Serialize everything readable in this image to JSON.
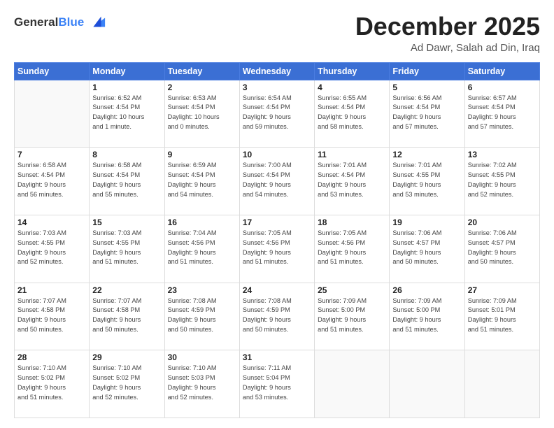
{
  "header": {
    "logo_general": "General",
    "logo_blue": "Blue",
    "month_title": "December 2025",
    "subtitle": "Ad Dawr, Salah ad Din, Iraq"
  },
  "weekdays": [
    "Sunday",
    "Monday",
    "Tuesday",
    "Wednesday",
    "Thursday",
    "Friday",
    "Saturday"
  ],
  "weeks": [
    [
      {
        "day": "",
        "info": ""
      },
      {
        "day": "1",
        "info": "Sunrise: 6:52 AM\nSunset: 4:54 PM\nDaylight: 10 hours\nand 1 minute."
      },
      {
        "day": "2",
        "info": "Sunrise: 6:53 AM\nSunset: 4:54 PM\nDaylight: 10 hours\nand 0 minutes."
      },
      {
        "day": "3",
        "info": "Sunrise: 6:54 AM\nSunset: 4:54 PM\nDaylight: 9 hours\nand 59 minutes."
      },
      {
        "day": "4",
        "info": "Sunrise: 6:55 AM\nSunset: 4:54 PM\nDaylight: 9 hours\nand 58 minutes."
      },
      {
        "day": "5",
        "info": "Sunrise: 6:56 AM\nSunset: 4:54 PM\nDaylight: 9 hours\nand 57 minutes."
      },
      {
        "day": "6",
        "info": "Sunrise: 6:57 AM\nSunset: 4:54 PM\nDaylight: 9 hours\nand 57 minutes."
      }
    ],
    [
      {
        "day": "7",
        "info": "Sunrise: 6:58 AM\nSunset: 4:54 PM\nDaylight: 9 hours\nand 56 minutes."
      },
      {
        "day": "8",
        "info": "Sunrise: 6:58 AM\nSunset: 4:54 PM\nDaylight: 9 hours\nand 55 minutes."
      },
      {
        "day": "9",
        "info": "Sunrise: 6:59 AM\nSunset: 4:54 PM\nDaylight: 9 hours\nand 54 minutes."
      },
      {
        "day": "10",
        "info": "Sunrise: 7:00 AM\nSunset: 4:54 PM\nDaylight: 9 hours\nand 54 minutes."
      },
      {
        "day": "11",
        "info": "Sunrise: 7:01 AM\nSunset: 4:54 PM\nDaylight: 9 hours\nand 53 minutes."
      },
      {
        "day": "12",
        "info": "Sunrise: 7:01 AM\nSunset: 4:55 PM\nDaylight: 9 hours\nand 53 minutes."
      },
      {
        "day": "13",
        "info": "Sunrise: 7:02 AM\nSunset: 4:55 PM\nDaylight: 9 hours\nand 52 minutes."
      }
    ],
    [
      {
        "day": "14",
        "info": "Sunrise: 7:03 AM\nSunset: 4:55 PM\nDaylight: 9 hours\nand 52 minutes."
      },
      {
        "day": "15",
        "info": "Sunrise: 7:03 AM\nSunset: 4:55 PM\nDaylight: 9 hours\nand 51 minutes."
      },
      {
        "day": "16",
        "info": "Sunrise: 7:04 AM\nSunset: 4:56 PM\nDaylight: 9 hours\nand 51 minutes."
      },
      {
        "day": "17",
        "info": "Sunrise: 7:05 AM\nSunset: 4:56 PM\nDaylight: 9 hours\nand 51 minutes."
      },
      {
        "day": "18",
        "info": "Sunrise: 7:05 AM\nSunset: 4:56 PM\nDaylight: 9 hours\nand 51 minutes."
      },
      {
        "day": "19",
        "info": "Sunrise: 7:06 AM\nSunset: 4:57 PM\nDaylight: 9 hours\nand 50 minutes."
      },
      {
        "day": "20",
        "info": "Sunrise: 7:06 AM\nSunset: 4:57 PM\nDaylight: 9 hours\nand 50 minutes."
      }
    ],
    [
      {
        "day": "21",
        "info": "Sunrise: 7:07 AM\nSunset: 4:58 PM\nDaylight: 9 hours\nand 50 minutes."
      },
      {
        "day": "22",
        "info": "Sunrise: 7:07 AM\nSunset: 4:58 PM\nDaylight: 9 hours\nand 50 minutes."
      },
      {
        "day": "23",
        "info": "Sunrise: 7:08 AM\nSunset: 4:59 PM\nDaylight: 9 hours\nand 50 minutes."
      },
      {
        "day": "24",
        "info": "Sunrise: 7:08 AM\nSunset: 4:59 PM\nDaylight: 9 hours\nand 50 minutes."
      },
      {
        "day": "25",
        "info": "Sunrise: 7:09 AM\nSunset: 5:00 PM\nDaylight: 9 hours\nand 51 minutes."
      },
      {
        "day": "26",
        "info": "Sunrise: 7:09 AM\nSunset: 5:00 PM\nDaylight: 9 hours\nand 51 minutes."
      },
      {
        "day": "27",
        "info": "Sunrise: 7:09 AM\nSunset: 5:01 PM\nDaylight: 9 hours\nand 51 minutes."
      }
    ],
    [
      {
        "day": "28",
        "info": "Sunrise: 7:10 AM\nSunset: 5:02 PM\nDaylight: 9 hours\nand 51 minutes."
      },
      {
        "day": "29",
        "info": "Sunrise: 7:10 AM\nSunset: 5:02 PM\nDaylight: 9 hours\nand 52 minutes."
      },
      {
        "day": "30",
        "info": "Sunrise: 7:10 AM\nSunset: 5:03 PM\nDaylight: 9 hours\nand 52 minutes."
      },
      {
        "day": "31",
        "info": "Sunrise: 7:11 AM\nSunset: 5:04 PM\nDaylight: 9 hours\nand 53 minutes."
      },
      {
        "day": "",
        "info": ""
      },
      {
        "day": "",
        "info": ""
      },
      {
        "day": "",
        "info": ""
      }
    ]
  ]
}
